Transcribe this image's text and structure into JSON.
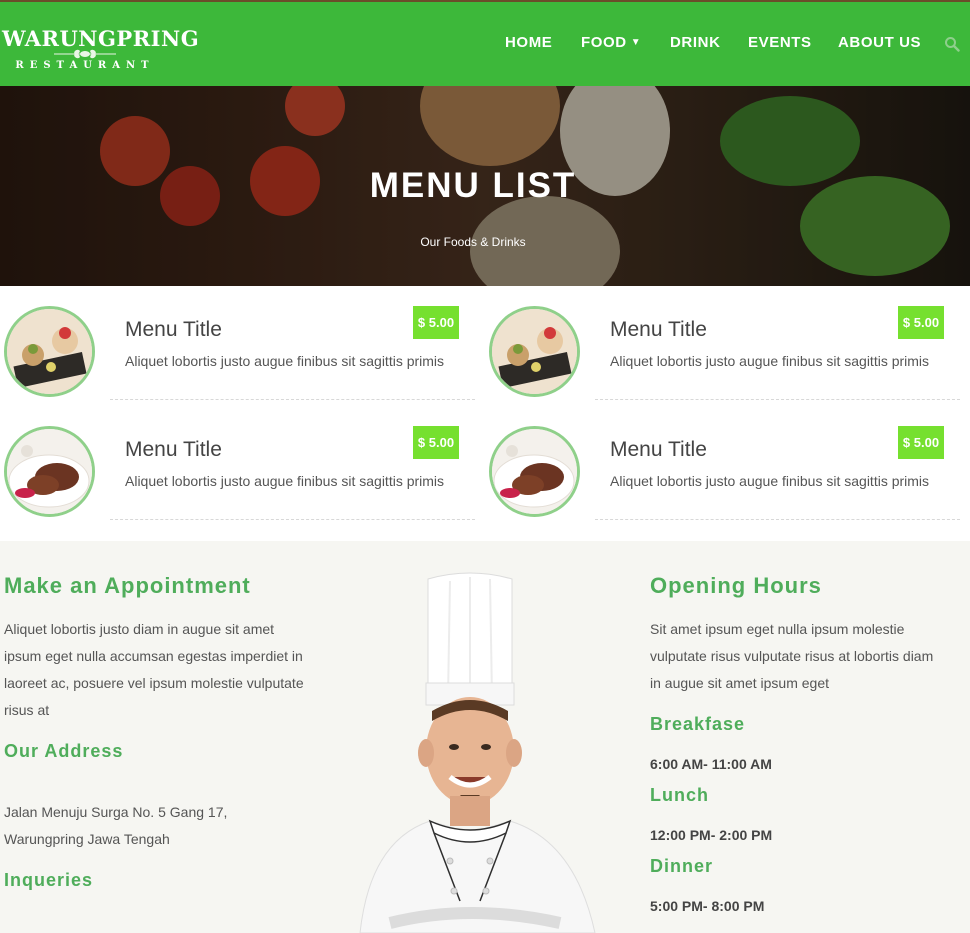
{
  "header": {
    "logo_text": "WARUNGPRING",
    "logo_sub": "RESTAURANT",
    "nav": [
      {
        "label": "HOME"
      },
      {
        "label": "FOOD",
        "dropdown": true
      },
      {
        "label": "DRINK"
      },
      {
        "label": "EVENTS"
      },
      {
        "label": "ABOUT US"
      }
    ],
    "search_icon": "search-icon",
    "accent_color": "#3db83a"
  },
  "hero": {
    "title": "MENU LIST",
    "subtitle": "Our Foods & Drinks"
  },
  "menu": {
    "price_color": "#76e02f",
    "items": [
      {
        "title": "Menu Title",
        "desc": "Aliquet lobortis justo augue finibus sit sagittis primis",
        "price": "$ 5.00",
        "image": "dessert-plate"
      },
      {
        "title": "Menu Title",
        "desc": "Aliquet lobortis justo augue finibus sit sagittis primis",
        "price": "$ 5.00",
        "image": "dessert-plate"
      },
      {
        "title": "Menu Title",
        "desc": "Aliquet lobortis justo augue finibus sit sagittis primis",
        "price": "$ 5.00",
        "image": "steak-plate"
      },
      {
        "title": "Menu Title",
        "desc": "Aliquet lobortis justo augue finibus sit sagittis primis",
        "price": "$ 5.00",
        "image": "steak-plate"
      }
    ]
  },
  "appointment": {
    "heading": "Make an Appointment",
    "text": "Aliquet lobortis justo diam in augue sit amet ipsum eget nulla accumsan egestas imperdiet in laoreet ac, posuere vel ipsum molestie vulputate risus at",
    "address_heading": "Our Address",
    "address": "Jalan Menuju Surga No. 5 Gang 17, Warungpring Jawa Tengah",
    "inquiries_heading": "Inqueries"
  },
  "hours": {
    "heading": "Opening Hours",
    "text": "Sit amet ipsum eget nulla ipsum molestie vulputate risus vulputate risus at lobortis diam in augue sit amet ipsum eget",
    "meals": [
      {
        "name": "Breakfase",
        "time": "6:00 AM- 11:00 AM"
      },
      {
        "name": "Lunch",
        "time": "12:00 PM- 2:00 PM"
      },
      {
        "name": "Dinner",
        "time": "5:00 PM- 8:00 PM"
      }
    ],
    "heading_color": "#4fad5b"
  }
}
